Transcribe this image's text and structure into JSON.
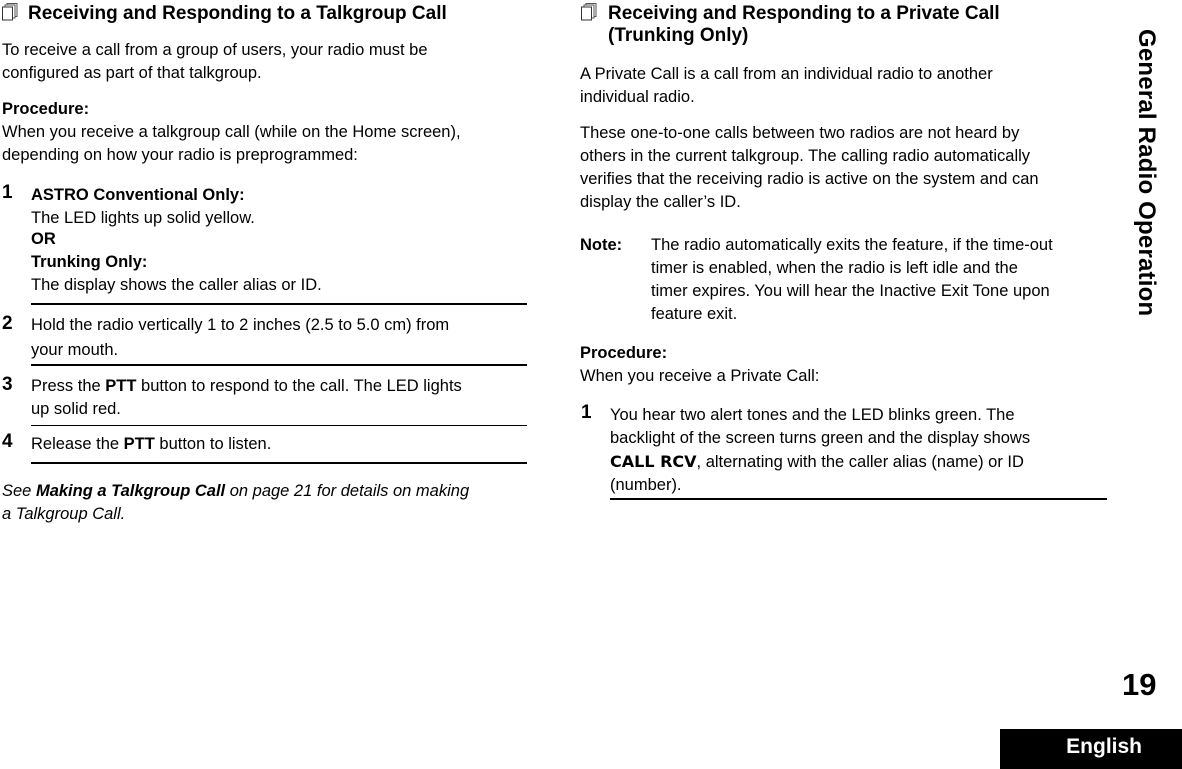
{
  "side_tab": {
    "title": "General Radio Operation"
  },
  "footer": {
    "page_number": "19",
    "language": "English"
  },
  "left": {
    "heading": "Receiving and Responding to a Talkgroup Call",
    "intro": [
      "To receive a call from a group of users, your radio must be",
      "configured as part of that talkgroup."
    ],
    "procedure_label": "Procedure:",
    "procedure_text": [
      "When you receive a talkgroup call (while on the Home screen),",
      "depending on how your radio is preprogrammed:"
    ],
    "steps": [
      {
        "number": "1",
        "astro_label": "ASTRO Conventional Only:",
        "astro_text": "The LED lights up solid yellow.",
        "or": "OR",
        "trunking_label": "Trunking Only:",
        "trunking_text": "The display shows the caller alias or ID."
      },
      {
        "number": "2",
        "lines": [
          "Hold the radio vertically 1 to 2 inches (2.5 to 5.0 cm) from",
          "your mouth."
        ]
      },
      {
        "number": "3",
        "pre": "Press the ",
        "bold": "PTT",
        "post": " button to respond to the call. The LED lights",
        "line2": "up solid red."
      },
      {
        "number": "4",
        "pre": "Release the ",
        "bold": "PTT",
        "post": " button to listen."
      }
    ],
    "see_also": {
      "pre": "See ",
      "link": "Making a Talkgroup Call",
      "post": " on page 21 for details on making",
      "line2": "a Talkgroup Call."
    }
  },
  "right": {
    "heading_line1": "Receiving and Responding to a Private Call",
    "heading_line2": "(Trunking Only)",
    "para1": [
      "A Private Call is a call from an individual radio to another",
      "individual radio."
    ],
    "para2": [
      "These one-to-one calls between two radios are not heard by",
      "others in the current talkgroup. The calling radio automatically",
      "verifies that the receiving radio is active on the system and can",
      "display the caller’s ID."
    ],
    "note_label": "Note:",
    "note_lines": [
      "The radio automatically exits the feature, if the time-out",
      "timer is enabled, when the radio is left idle and the",
      "timer expires. You will hear the Inactive Exit Tone upon",
      "feature exit."
    ],
    "procedure_label": "Procedure:",
    "procedure_text": "When you receive a Private Call:",
    "step1": {
      "number": "1",
      "line1": "You hear two alert tones and the LED blinks green. The",
      "line2": "backlight of the screen turns green and the display shows",
      "display_text": "CALL RCV",
      "line3_post": ", alternating with the caller alias (name) or ID",
      "line4": "(number)."
    }
  }
}
